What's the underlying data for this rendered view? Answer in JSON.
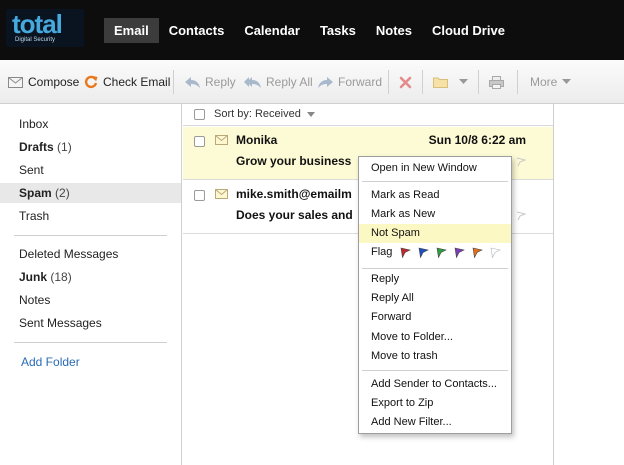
{
  "brand": {
    "name": "total",
    "tagline": "Digital Security",
    "accent": "#45a9de"
  },
  "nav": {
    "tabs": [
      {
        "label": "Email",
        "active": true
      },
      {
        "label": "Contacts",
        "active": false
      },
      {
        "label": "Calendar",
        "active": false
      },
      {
        "label": "Tasks",
        "active": false
      },
      {
        "label": "Notes",
        "active": false
      },
      {
        "label": "Cloud Drive",
        "active": false
      }
    ]
  },
  "toolbar": {
    "compose": "Compose",
    "check_email": "Check Email",
    "reply": "Reply",
    "reply_all": "Reply All",
    "forward": "Forward",
    "more": "More"
  },
  "sidebar": {
    "folders": [
      {
        "label": "Inbox",
        "count": "",
        "bold": false,
        "selected": false
      },
      {
        "label": "Drafts",
        "count": "(1)",
        "bold": true,
        "selected": false
      },
      {
        "label": "Sent",
        "count": "",
        "bold": false,
        "selected": false
      },
      {
        "label": "Spam",
        "count": "(2)",
        "bold": true,
        "selected": true
      },
      {
        "label": "Trash",
        "count": "",
        "bold": false,
        "selected": false
      }
    ],
    "other_folders": [
      {
        "label": "Deleted Messages",
        "count": "",
        "bold": false
      },
      {
        "label": "Junk",
        "count": "(18)",
        "bold": true
      },
      {
        "label": "Notes",
        "count": "",
        "bold": false
      },
      {
        "label": "Sent Messages",
        "count": "",
        "bold": false
      }
    ],
    "add_folder": "Add Folder"
  },
  "list": {
    "sort_label": "Sort by: Received",
    "messages": [
      {
        "sender": "Monika",
        "date": "Sun 10/8 6:22 am",
        "subject": "Grow your business",
        "highlighted": true
      },
      {
        "sender": "mike.smith@emailm",
        "date": "",
        "subject": "Does your sales and",
        "highlighted": false
      }
    ]
  },
  "context_menu": {
    "open_new_window": "Open in New Window",
    "mark_read": "Mark as Read",
    "mark_new": "Mark as New",
    "not_spam": "Not Spam",
    "flag_label": "Flag",
    "flag_colors": [
      "#c0282d",
      "#1f4fbf",
      "#2f9e3a",
      "#7a3db4",
      "#e0701c",
      "#ffffff"
    ],
    "reply": "Reply",
    "reply_all": "Reply All",
    "forward": "Forward",
    "move_folder": "Move to Folder...",
    "move_trash": "Move to trash",
    "add_sender": "Add Sender to Contacts...",
    "export_zip": "Export to Zip",
    "add_filter": "Add New Filter..."
  }
}
